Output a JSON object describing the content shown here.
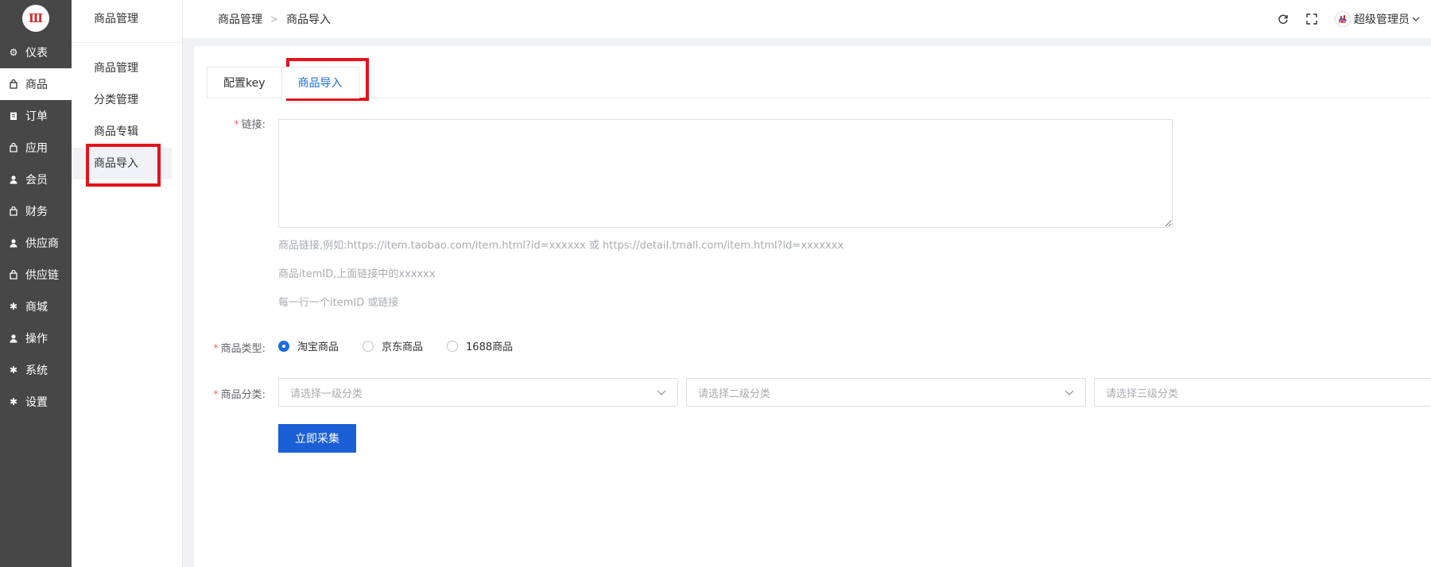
{
  "nav": {
    "logo_text": "Ⅲ",
    "items": [
      {
        "label": "仪表",
        "icon": "dashboard-icon"
      },
      {
        "label": "商品",
        "icon": "bag-icon",
        "active": true
      },
      {
        "label": "订单",
        "icon": "clipboard-icon"
      },
      {
        "label": "应用",
        "icon": "bag-icon"
      },
      {
        "label": "会员",
        "icon": "user-icon"
      },
      {
        "label": "财务",
        "icon": "bag-icon"
      },
      {
        "label": "供应商",
        "icon": "user-icon"
      },
      {
        "label": "供应链",
        "icon": "bag-icon"
      },
      {
        "label": "商城",
        "icon": "gear-icon"
      },
      {
        "label": "操作",
        "icon": "user-icon"
      },
      {
        "label": "系统",
        "icon": "gear-icon"
      },
      {
        "label": "设置",
        "icon": "gear-icon"
      }
    ]
  },
  "submenu": {
    "title": "商品管理",
    "items": [
      {
        "label": "商品管理"
      },
      {
        "label": "分类管理"
      },
      {
        "label": "商品专辑"
      },
      {
        "label": "商品导入",
        "active": true
      }
    ]
  },
  "header": {
    "breadcrumb": [
      "商品管理",
      "商品导入"
    ],
    "user_name": "超级管理员"
  },
  "tabs": [
    {
      "label": "配置key"
    },
    {
      "label": "商品导入",
      "active": true
    }
  ],
  "form": {
    "link_label": "链接:",
    "link_value": "",
    "hints": [
      "商品链接,例如:https://item.taobao.com/item.html?id=xxxxxx 或 https://detail.tmall.com/item.html?id=xxxxxxx",
      "商品itemID,上面链接中的xxxxxx",
      "每一行一个itemID 或链接"
    ],
    "type_label": "商品类型:",
    "type_options": [
      {
        "label": "淘宝商品",
        "checked": true
      },
      {
        "label": "京东商品",
        "checked": false
      },
      {
        "label": "1688商品",
        "checked": false
      }
    ],
    "category_label": "商品分类:",
    "category_placeholders": [
      "请选择一级分类",
      "请选择二级分类",
      "请选择三级分类"
    ],
    "submit_label": "立即采集"
  },
  "colors": {
    "nav_bg": "#474747",
    "accent": "#1a5fd6",
    "highlight": "#e2131b",
    "required": "#f56c6c"
  }
}
